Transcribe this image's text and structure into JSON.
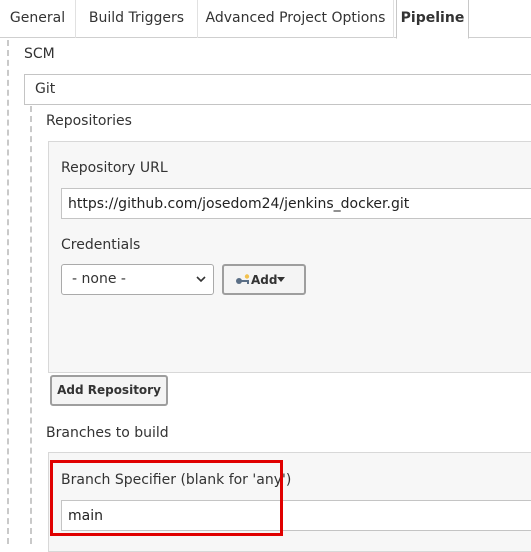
{
  "tabs": [
    {
      "label": "General",
      "active": false
    },
    {
      "label": "Build Triggers",
      "active": false
    },
    {
      "label": "Advanced Project Options",
      "active": false
    },
    {
      "label": "Pipeline",
      "active": true
    }
  ],
  "scm": {
    "label": "SCM",
    "selected": "Git"
  },
  "repositories": {
    "label": "Repositories",
    "repository_url_label": "Repository URL",
    "repository_url_value": "https://github.com/josedom24/jenkins_docker.git",
    "credentials_label": "Credentials",
    "credentials_selected": "- none -",
    "add_button_label": "Add",
    "add_repository_button_label": "Add Repository"
  },
  "branches": {
    "label": "Branches to build",
    "branch_specifier_label": "Branch Specifier (blank for 'any')",
    "branch_specifier_value": "main"
  },
  "colors": {
    "highlight": "#e00000",
    "panel_bg": "#f7f7f7",
    "border": "#c4c4c4"
  },
  "icons": {
    "credentials_add": "key-icon",
    "dropdown": "chevron-down-icon",
    "add_caret": "caret-down-icon"
  }
}
